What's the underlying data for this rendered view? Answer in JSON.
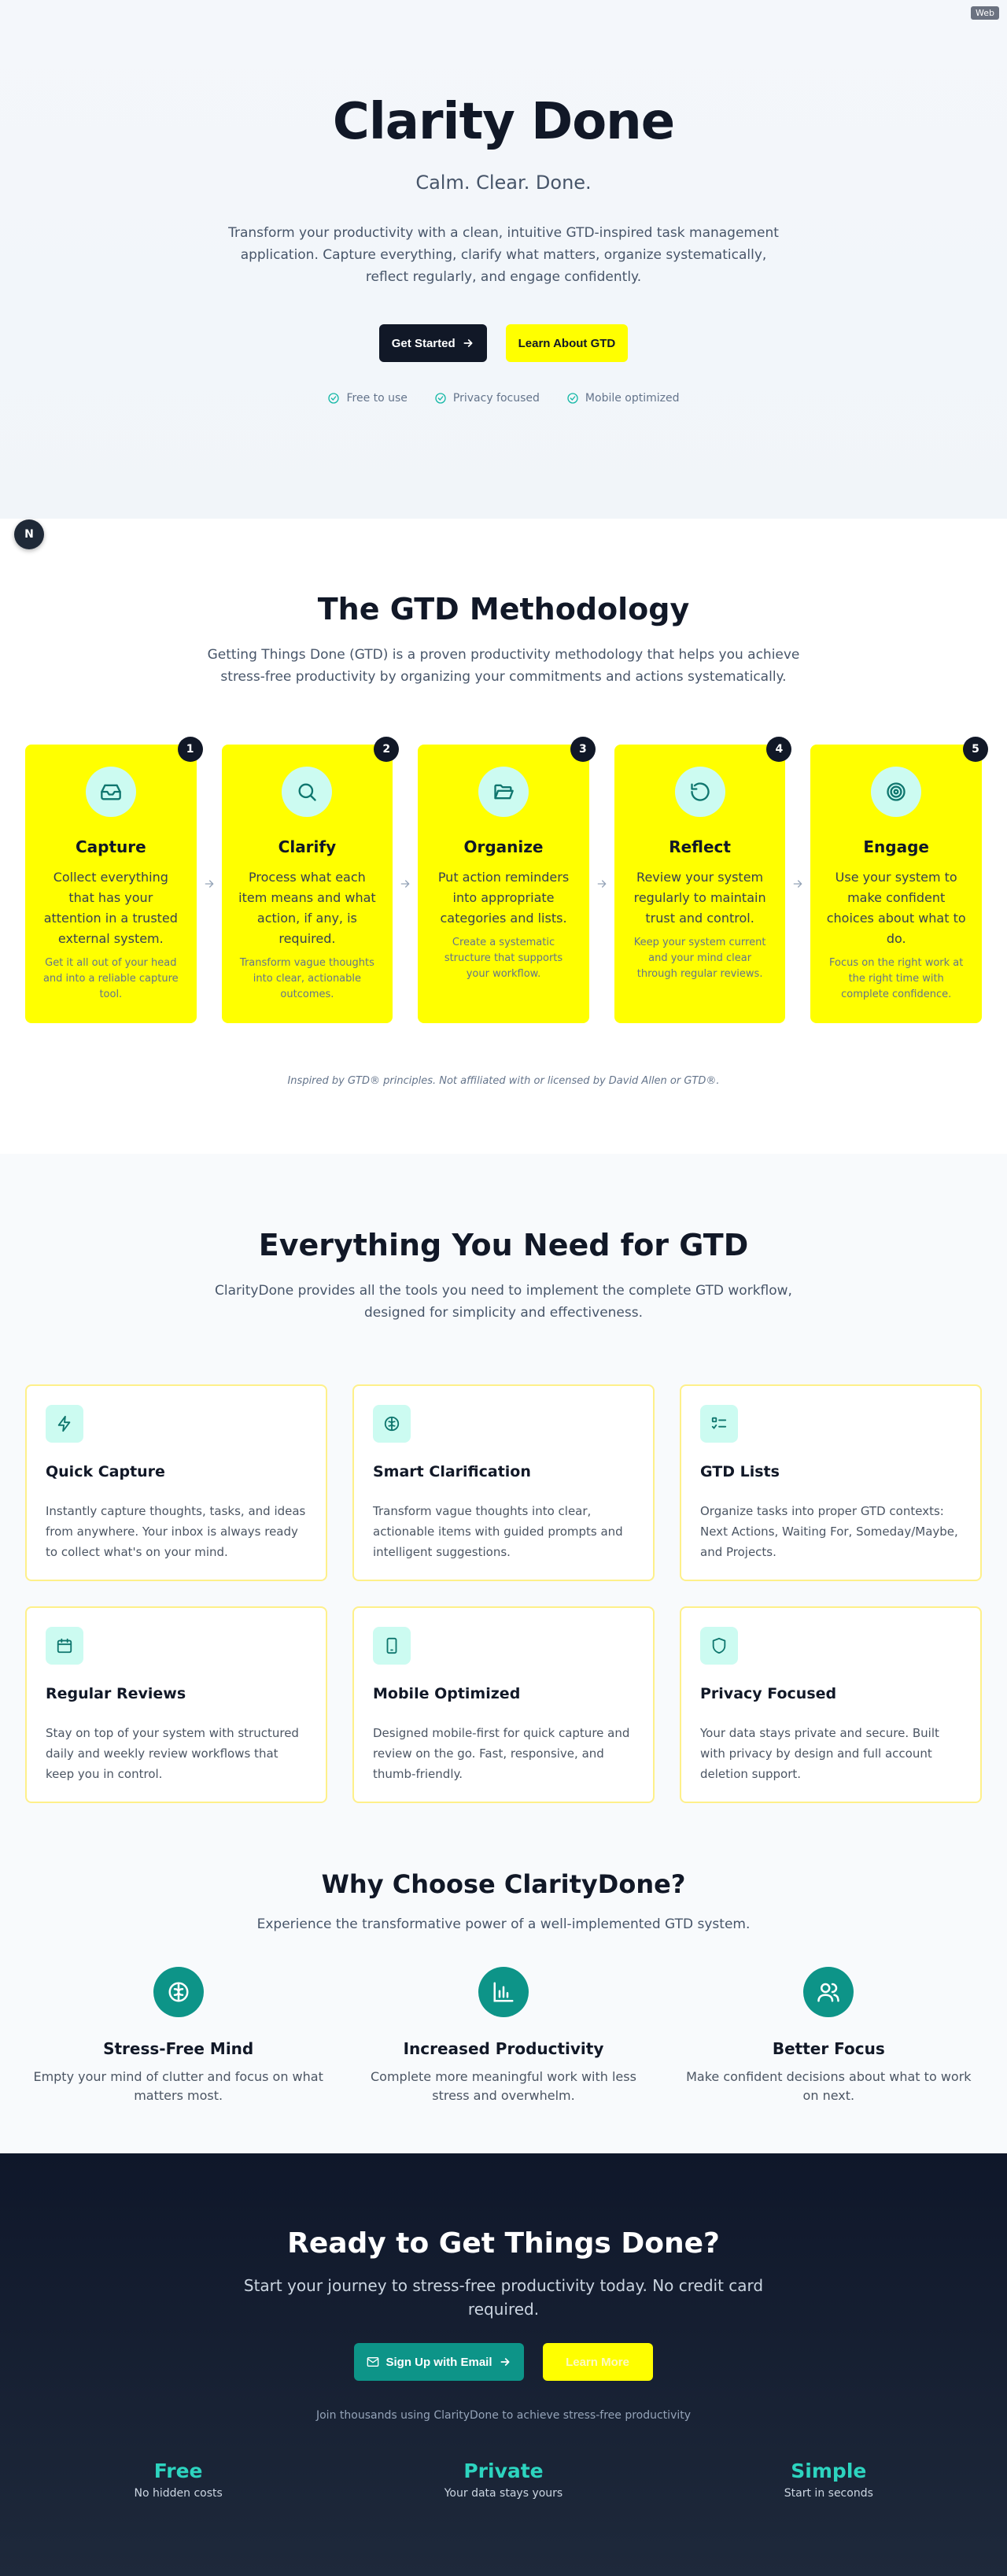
{
  "env_tag": "Web",
  "hero": {
    "title": "Clarity Done",
    "tagline": "Calm. Clear. Done.",
    "description": "Transform your productivity with a clean, intuitive GTD-inspired task management application. Capture everything, clarify what matters, organize systematically, reflect regularly, and engage confidently.",
    "primary_button": "Get Started",
    "secondary_button": "Learn About GTD",
    "checks": [
      "Free to use",
      "Privacy focused",
      "Mobile optimized"
    ]
  },
  "dev_badge": "N",
  "gtd": {
    "title": "The GTD Methodology",
    "subtitle": "Getting Things Done (GTD) is a proven productivity methodology that helps you achieve stress-free productivity by organizing your commitments and actions systematically.",
    "steps": [
      {
        "num": "1",
        "icon": "inbox-icon",
        "title": "Capture",
        "main": "Collect everything that has your attention in a trusted external system.",
        "small": "Get it all out of your head and into a reliable capture tool."
      },
      {
        "num": "2",
        "icon": "search-icon",
        "title": "Clarify",
        "main": "Process what each item means and what action, if any, is required.",
        "small": "Transform vague thoughts into clear, actionable outcomes."
      },
      {
        "num": "3",
        "icon": "folder-open-icon",
        "title": "Organize",
        "main": "Put action reminders into appropriate categories and lists.",
        "small": "Create a systematic structure that supports your workflow."
      },
      {
        "num": "4",
        "icon": "rotate-icon",
        "title": "Reflect",
        "main": "Review your system regularly to maintain trust and control.",
        "small": "Keep your system current and your mind clear through regular reviews."
      },
      {
        "num": "5",
        "icon": "target-icon",
        "title": "Engage",
        "main": "Use your system to make confident choices about what to do.",
        "small": "Focus on the right work at the right time with complete confidence."
      }
    ],
    "note": "Inspired by GTD® principles. Not affiliated with or licensed by David Allen or GTD®."
  },
  "features": {
    "title": "Everything You Need for GTD",
    "subtitle": "ClarityDone provides all the tools you need to implement the complete GTD workflow, designed for simplicity and effectiveness.",
    "cards": [
      {
        "icon": "zap-icon",
        "title": "Quick Capture",
        "text": "Instantly capture thoughts, tasks, and ideas from anywhere. Your inbox is always ready to collect what's on your mind."
      },
      {
        "icon": "brain-icon",
        "title": "Smart Clarification",
        "text": "Transform vague thoughts into clear, actionable items with guided prompts and intelligent suggestions."
      },
      {
        "icon": "list-checks-icon",
        "title": "GTD Lists",
        "text": "Organize tasks into proper GTD contexts: Next Actions, Waiting For, Someday/Maybe, and Projects."
      },
      {
        "icon": "calendar-icon",
        "title": "Regular Reviews",
        "text": "Stay on top of your system with structured daily and weekly review workflows that keep you in control."
      },
      {
        "icon": "smartphone-icon",
        "title": "Mobile Optimized",
        "text": "Designed mobile-first for quick capture and review on the go. Fast, responsive, and thumb-friendly."
      },
      {
        "icon": "shield-icon",
        "title": "Privacy Focused",
        "text": "Your data stays private and secure. Built with privacy by design and full account deletion support."
      }
    ]
  },
  "why": {
    "title": "Why Choose ClarityDone?",
    "subtitle": "Experience the transformative power of a well-implemented GTD system.",
    "items": [
      {
        "icon": "brain-icon",
        "title": "Stress-Free Mind",
        "text": "Empty your mind of clutter and focus on what matters most."
      },
      {
        "icon": "bar-chart-icon",
        "title": "Increased Productivity",
        "text": "Complete more meaningful work with less stress and overwhelm."
      },
      {
        "icon": "users-icon",
        "title": "Better Focus",
        "text": "Make confident decisions about what to work on next."
      }
    ]
  },
  "cta": {
    "title": "Ready to Get Things Done?",
    "subtitle": "Start your journey to stress-free productivity today. No credit card required.",
    "primary_button": "Sign Up with Email",
    "secondary_button": "Learn More",
    "join": "Join thousands using ClarityDone to achieve stress-free productivity",
    "stats": [
      {
        "value": "Free",
        "label": "No hidden costs"
      },
      {
        "value": "Private",
        "label": "Your data stays yours"
      },
      {
        "value": "Simple",
        "label": "Start in seconds"
      }
    ]
  },
  "colors": {
    "accent_teal": "#0d9488",
    "accent_yellow": "#ffff00",
    "dark": "#111827"
  }
}
